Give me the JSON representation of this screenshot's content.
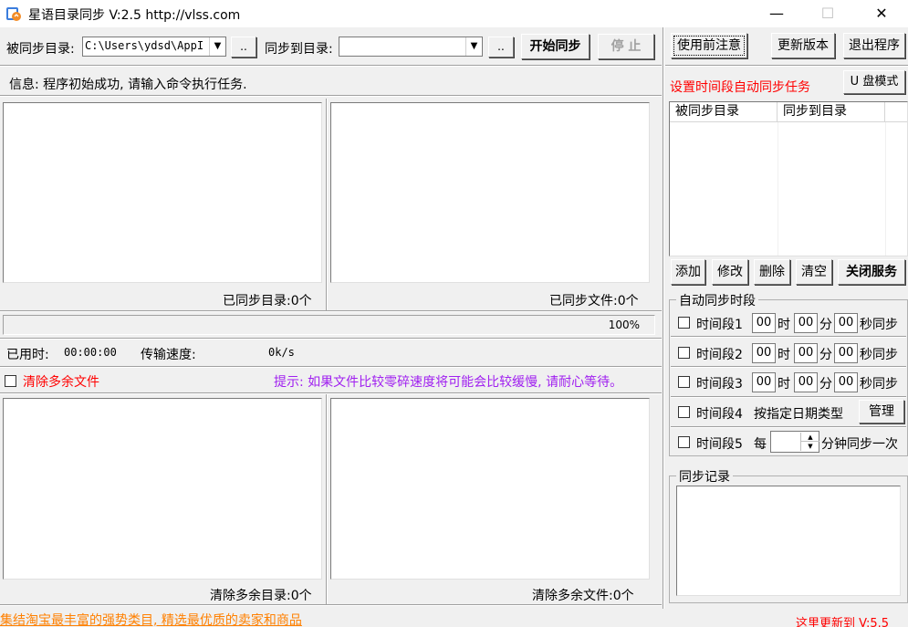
{
  "window": {
    "title": "星语目录同步 V:2.5 http://vlss.com",
    "minimize": "—",
    "maximize": "☐",
    "close": "✕"
  },
  "toolbar": {
    "source_label": "被同步目录:",
    "source_value": "C:\\Users\\ydsd\\AppI",
    "source_browse": "..",
    "target_label": "同步到目录:",
    "target_value": "",
    "target_browse": "..",
    "start_button": "开始同步",
    "stop_button": "停 止"
  },
  "info": {
    "message": "信息: 程序初始成功, 请输入命令执行任务."
  },
  "sync_panels": {
    "synced_dirs": "已同步目录:0个",
    "synced_files": "已同步文件:0个",
    "progress_text": "100%",
    "progress_fraction": 1.0
  },
  "stats": {
    "elapsed_label": "已用时:",
    "elapsed_value": "00:00:00",
    "speed_label": "传输速度:",
    "speed_value": "0k/s"
  },
  "cleanup": {
    "checkbox_label": "清除多余文件",
    "hint": "提示: 如果文件比较零碎速度将可能会比较缓慢, 请耐心等待。",
    "extra_dirs": "清除多余目录:0个",
    "extra_files": "清除多余文件:0个"
  },
  "footer": {
    "left_text": "集结淘宝最丰富的强势类目, 精选最优质的卖家和商品",
    "right_text": "这里更新到 V:5.5"
  },
  "right": {
    "notice_button": "使用前注意",
    "update_button": "更新版本",
    "exit_button": "退出程序",
    "schedule_title": "设置时间段自动同步任务",
    "usb_button": "U 盘模式",
    "columns": [
      "被同步目录",
      "同步到目录"
    ],
    "add_button": "添加",
    "edit_button": "修改",
    "delete_button": "删除",
    "clear_button": "清空",
    "close_service_button": "关闭服务",
    "auto_group_title": "自动同步时段",
    "periods": [
      {
        "label": "时间段1",
        "h": "00",
        "m": "00",
        "s": "00",
        "hour_unit": "时",
        "minute_unit": "分",
        "suffix": "秒同步"
      },
      {
        "label": "时间段2",
        "h": "00",
        "m": "00",
        "s": "00",
        "hour_unit": "时",
        "minute_unit": "分",
        "suffix": "秒同步"
      },
      {
        "label": "时间段3",
        "h": "00",
        "m": "00",
        "s": "00",
        "hour_unit": "时",
        "minute_unit": "分",
        "suffix": "秒同步"
      }
    ],
    "period4_label": "时间段4",
    "period4_text": "按指定日期类型",
    "manage_button": "管理",
    "period5_label": "时间段5",
    "period5_every": "每",
    "period5_value": "",
    "period5_suffix": "分钟同步一次",
    "log_title": "同步记录"
  }
}
